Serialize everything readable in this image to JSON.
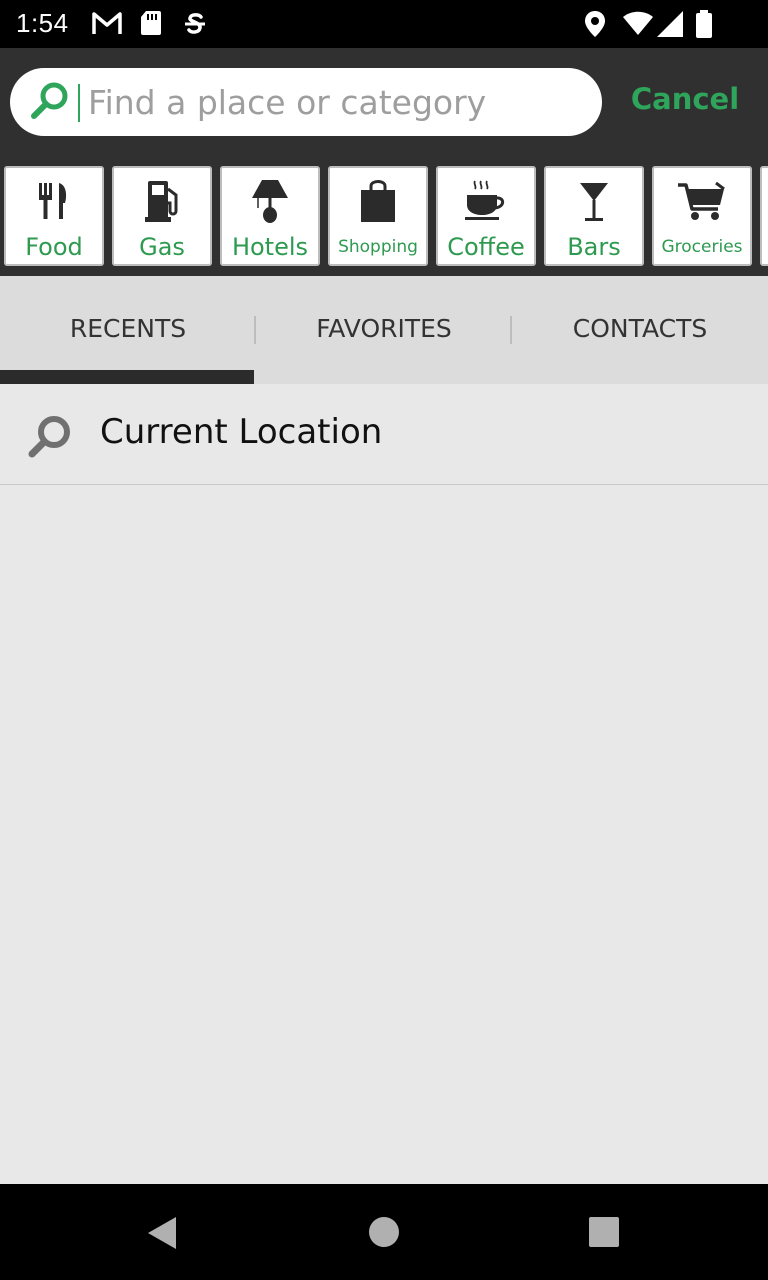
{
  "status_bar": {
    "time": "1:54",
    "icons": [
      "gmail-icon",
      "sd-card-icon",
      "sync-icon",
      "location-icon",
      "wifi-icon",
      "signal-icon",
      "battery-icon"
    ]
  },
  "search": {
    "placeholder": "Find a place or category",
    "value": "",
    "cancel_label": "Cancel"
  },
  "categories": [
    {
      "label": "Food",
      "icon": "fork-knife-icon"
    },
    {
      "label": "Gas",
      "icon": "gas-pump-icon"
    },
    {
      "label": "Hotels",
      "icon": "lamp-icon"
    },
    {
      "label": "Shopping",
      "icon": "shopping-bag-icon"
    },
    {
      "label": "Coffee",
      "icon": "coffee-cup-icon"
    },
    {
      "label": "Bars",
      "icon": "cocktail-icon"
    },
    {
      "label": "Groceries",
      "icon": "shopping-cart-icon"
    }
  ],
  "tabs": [
    {
      "label": "RECENTS",
      "active": true
    },
    {
      "label": "FAVORITES",
      "active": false
    },
    {
      "label": "CONTACTS",
      "active": false
    }
  ],
  "list": [
    {
      "label": "Current Location",
      "icon": "search-icon"
    }
  ],
  "colors": {
    "accent": "#2ea55a",
    "header_bg": "#303030",
    "page_bg": "#e8e8e8"
  }
}
